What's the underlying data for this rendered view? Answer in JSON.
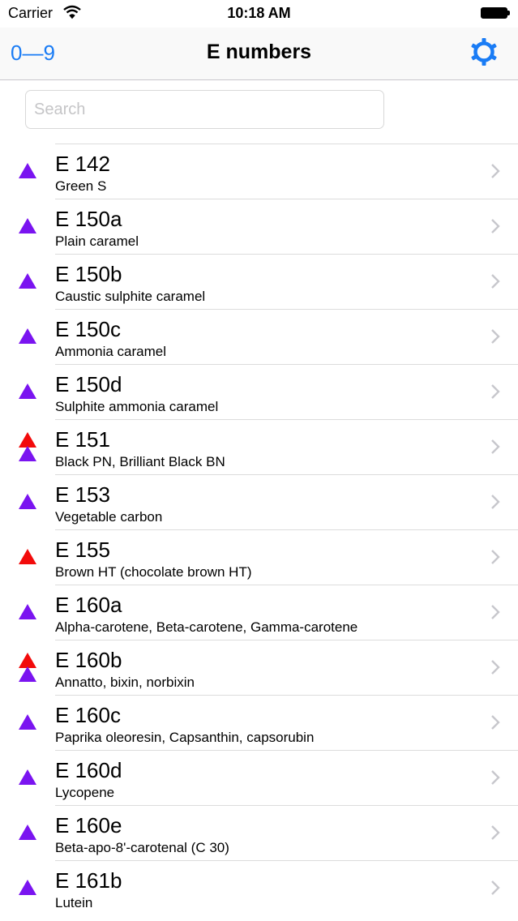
{
  "status": {
    "carrier": "Carrier",
    "time": "10:18 AM"
  },
  "nav": {
    "left": "0—9",
    "title": "E numbers",
    "settings_icon": "gear-icon"
  },
  "search": {
    "placeholder": "Search",
    "value": ""
  },
  "colors": {
    "accent": "#1a7cf5",
    "purple": "#7a14f0",
    "red": "#f20b0b"
  },
  "items": [
    {
      "code": "E 142",
      "name": "Green S",
      "indicators": [
        "purple"
      ]
    },
    {
      "code": "E 150a",
      "name": "Plain caramel",
      "indicators": [
        "purple"
      ]
    },
    {
      "code": "E 150b",
      "name": "Caustic sulphite caramel",
      "indicators": [
        "purple"
      ]
    },
    {
      "code": "E 150c",
      "name": "Ammonia caramel",
      "indicators": [
        "purple"
      ]
    },
    {
      "code": "E 150d",
      "name": "Sulphite ammonia caramel",
      "indicators": [
        "purple"
      ]
    },
    {
      "code": "E 151",
      "name": "Black PN, Brilliant Black BN",
      "indicators": [
        "red",
        "purple"
      ]
    },
    {
      "code": "E 153",
      "name": "Vegetable carbon",
      "indicators": [
        "purple"
      ]
    },
    {
      "code": "E 155",
      "name": "Brown HT (chocolate brown HT)",
      "indicators": [
        "red"
      ]
    },
    {
      "code": "E 160a",
      "name": "Alpha-carotene, Beta-carotene, Gamma-carotene",
      "indicators": [
        "purple"
      ]
    },
    {
      "code": "E 160b",
      "name": "Annatto, bixin, norbixin",
      "indicators": [
        "red",
        "purple"
      ]
    },
    {
      "code": "E 160c",
      "name": "Paprika oleoresin, Capsanthin, capsorubin",
      "indicators": [
        "purple"
      ]
    },
    {
      "code": "E 160d",
      "name": "Lycopene",
      "indicators": [
        "purple"
      ]
    },
    {
      "code": "E 160e",
      "name": "Beta-apo-8'-carotenal (C 30)",
      "indicators": [
        "purple"
      ]
    },
    {
      "code": "E 161b",
      "name": "Lutein",
      "indicators": [
        "purple"
      ]
    }
  ]
}
